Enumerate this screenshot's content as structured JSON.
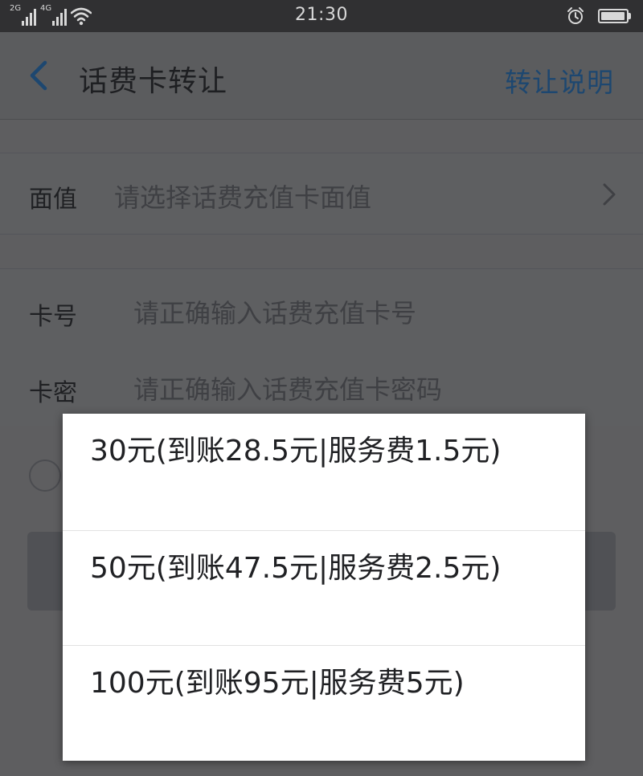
{
  "status_bar": {
    "net1_label": "2G",
    "net2_label": "4G",
    "time": "21:30",
    "battery_level": 0.95,
    "icons": [
      "signal-icon",
      "wifi-icon",
      "alarm-icon",
      "battery-icon"
    ]
  },
  "header": {
    "back_icon": "chevron-left-icon",
    "title": "话费卡转让",
    "info_link": "转让说明",
    "link_color": "#1d4770"
  },
  "form": {
    "face_value": {
      "label": "面值",
      "placeholder": "请选择话费充值卡面值",
      "icon": "chevron-right-icon"
    },
    "card_number": {
      "label": "卡号",
      "placeholder": "请正确输入话费充值卡号"
    },
    "card_password": {
      "label": "卡密",
      "placeholder": "请正确输入话费充值卡密码"
    }
  },
  "dropdown": {
    "options": [
      "30元(到账28.5元|服务费1.5元)",
      "50元(到账47.5元|服务费2.5元)",
      "100元(到账95元|服务费5元)"
    ]
  }
}
